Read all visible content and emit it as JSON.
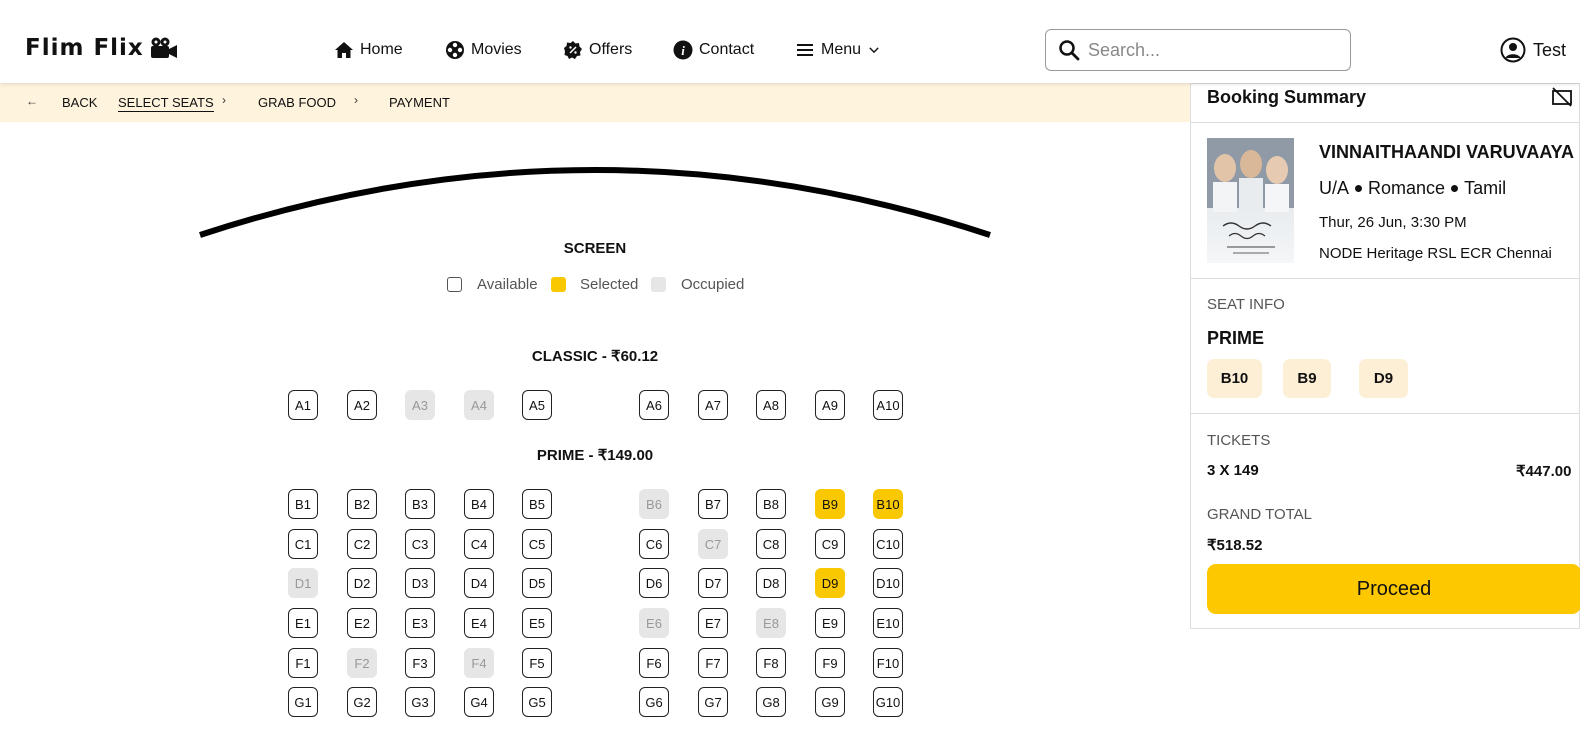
{
  "header": {
    "logo": "Flim Flix",
    "nav": [
      {
        "label": "Home",
        "icon": "home-icon"
      },
      {
        "label": "Movies",
        "icon": "film-reel-icon"
      },
      {
        "label": "Offers",
        "icon": "discount-badge-icon"
      },
      {
        "label": "Contact",
        "icon": "info-icon"
      },
      {
        "label": "Menu",
        "icon": "hamburger-icon"
      }
    ],
    "search_placeholder": "Search...",
    "user_label": "Test"
  },
  "breadcrumb": {
    "back": "BACK",
    "steps": [
      "SELECT SEATS",
      "GRAB FOOD",
      "PAYMENT"
    ],
    "active_step": "SELECT SEATS"
  },
  "screen": {
    "label": "SCREEN",
    "legend": {
      "available": "Available",
      "selected": "Selected",
      "occupied": "Occupied"
    }
  },
  "colors": {
    "selected": "#f9c800",
    "occupied": "#e6e6e6",
    "breadcrumb_bg": "#fef3dc",
    "proceed": "#fdc800",
    "chip": "#fdefd6"
  },
  "sections": [
    {
      "title": "CLASSIC - ₹60.12",
      "rows": [
        {
          "row": "A",
          "seats": [
            "A1",
            "A2",
            "A3",
            "A4",
            "A5",
            "A6",
            "A7",
            "A8",
            "A9",
            "A10"
          ],
          "occupied": [
            "A3",
            "A4"
          ],
          "selected": []
        }
      ]
    },
    {
      "title": "PRIME - ₹149.00",
      "rows": [
        {
          "row": "B",
          "seats": [
            "B1",
            "B2",
            "B3",
            "B4",
            "B5",
            "B6",
            "B7",
            "B8",
            "B9",
            "B10"
          ],
          "occupied": [
            "B6"
          ],
          "selected": [
            "B9",
            "B10"
          ]
        },
        {
          "row": "C",
          "seats": [
            "C1",
            "C2",
            "C3",
            "C4",
            "C5",
            "C6",
            "C7",
            "C8",
            "C9",
            "C10"
          ],
          "occupied": [
            "C7"
          ],
          "selected": []
        },
        {
          "row": "D",
          "seats": [
            "D1",
            "D2",
            "D3",
            "D4",
            "D5",
            "D6",
            "D7",
            "D8",
            "D9",
            "D10"
          ],
          "occupied": [
            "D1"
          ],
          "selected": [
            "D9"
          ]
        },
        {
          "row": "E",
          "seats": [
            "E1",
            "E2",
            "E3",
            "E4",
            "E5",
            "E6",
            "E7",
            "E8",
            "E9",
            "E10"
          ],
          "occupied": [
            "E6",
            "E8"
          ],
          "selected": []
        },
        {
          "row": "F",
          "seats": [
            "F1",
            "F2",
            "F3",
            "F4",
            "F5",
            "F6",
            "F7",
            "F8",
            "F9",
            "F10"
          ],
          "occupied": [
            "F2",
            "F4"
          ],
          "selected": []
        },
        {
          "row": "G",
          "seats": [
            "G1",
            "G2",
            "G3",
            "G4",
            "G5",
            "G6",
            "G7",
            "G8",
            "G9",
            "G10"
          ],
          "occupied": [],
          "selected": []
        }
      ]
    }
  ],
  "summary": {
    "title": "Booking Summary",
    "movie": {
      "title": "VINNAITHAANDI VARUVAAYA",
      "rating": "U/A",
      "genre": "Romance",
      "language": "Tamil",
      "datetime": "Thur, 26 Jun, 3:30 PM",
      "venue": "NODE Heritage RSL ECR Chennai"
    },
    "seat_info_label": "SEAT INFO",
    "tier": "PRIME",
    "seats": [
      "B10",
      "B9",
      "D9"
    ],
    "tickets_label": "TICKETS",
    "tickets_qty": "3 X 149",
    "tickets_amount": "₹447.00",
    "grand_total_label": "GRAND TOTAL",
    "grand_total": "₹518.52",
    "proceed_label": "Proceed"
  }
}
